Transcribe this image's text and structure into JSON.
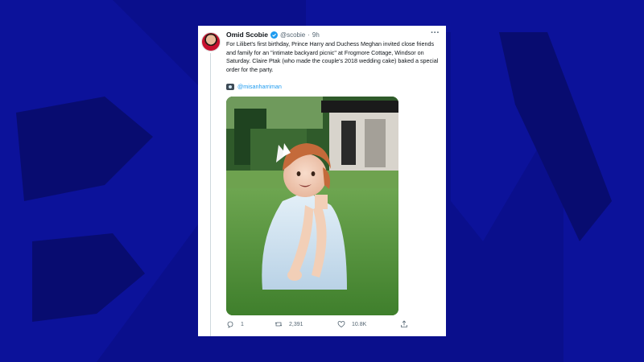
{
  "colors": {
    "background": "#0a0f8c",
    "logo_overlay": "#0d1495",
    "link": "#1d9bf0",
    "verified": "#1d9bf0"
  },
  "tweet": {
    "author_name": "Omid Scobie",
    "handle": "@scobie",
    "separator": "·",
    "time": "9h",
    "more_icon": "more-horizontal-icon",
    "text": "For Lilibet's first birthday, Prince Harry and Duchess Meghan invited close friends and family for an \"intimate backyard picnic\" at Frogmore Cottage, Windsor on Saturday. Claire Ptak (who made the couple's 2018 wedding cake) baked a special order for the party.",
    "photo_credit_icon": "camera-icon",
    "photo_credit": "@misanharriman"
  },
  "actions": {
    "replies": "1",
    "retweets": "2,391",
    "likes": "10.8K"
  }
}
